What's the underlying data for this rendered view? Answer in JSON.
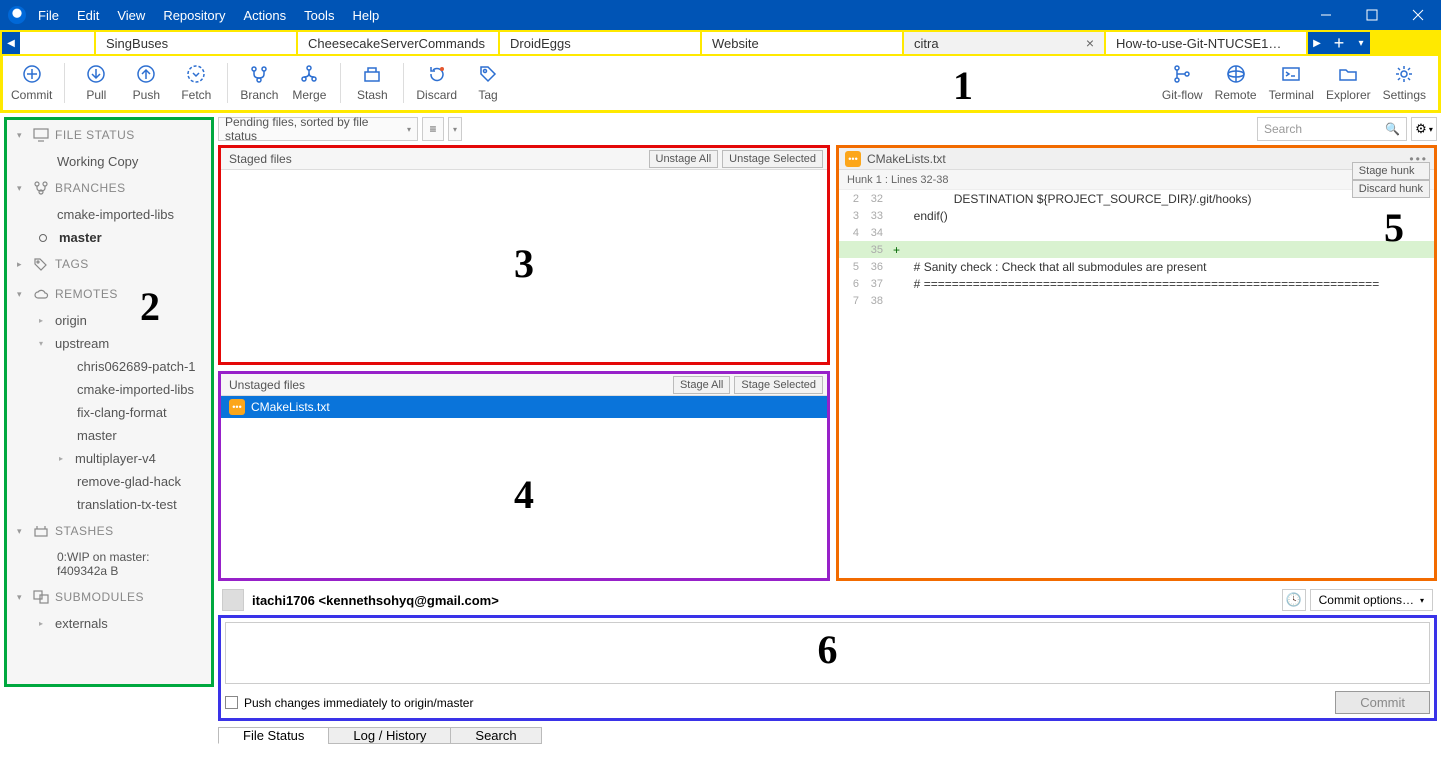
{
  "menu": [
    "File",
    "Edit",
    "View",
    "Repository",
    "Actions",
    "Tools",
    "Help"
  ],
  "tabs": {
    "left_blank": "",
    "items": [
      "SingBuses",
      "CheesecakeServerCommands",
      "DroidEggs",
      "Website",
      "citra",
      "How-to-use-Git-NTUCSE1…"
    ],
    "active": "citra"
  },
  "toolbar": {
    "commit": "Commit",
    "pull": "Pull",
    "push": "Push",
    "fetch": "Fetch",
    "branch": "Branch",
    "merge": "Merge",
    "stash": "Stash",
    "discard": "Discard",
    "tag": "Tag",
    "gitflow": "Git-flow",
    "remote": "Remote",
    "terminal": "Terminal",
    "explorer": "Explorer",
    "settings": "Settings"
  },
  "sidebar": {
    "file_status": {
      "header": "FILE STATUS",
      "working": "Working Copy"
    },
    "branches": {
      "header": "BRANCHES",
      "items": [
        "cmake-imported-libs",
        "master"
      ]
    },
    "tags": {
      "header": "TAGS"
    },
    "remotes": {
      "header": "REMOTES",
      "origin": "origin",
      "upstream": "upstream",
      "upstream_items": [
        "chris062689-patch-1",
        "cmake-imported-libs",
        "fix-clang-format",
        "master",
        "multiplayer-v4",
        "remove-glad-hack",
        "translation-tx-test"
      ]
    },
    "stashes": {
      "header": "STASHES",
      "item": "0:WIP on master: f409342a B"
    },
    "submodules": {
      "header": "SUBMODULES",
      "item": "externals"
    }
  },
  "filter": {
    "sort": "Pending files, sorted by file status",
    "search_placeholder": "Search"
  },
  "staged": {
    "title": "Staged files",
    "unstage_all": "Unstage All",
    "unstage_sel": "Unstage Selected"
  },
  "unstaged": {
    "title": "Unstaged files",
    "stage_all": "Stage All",
    "stage_sel": "Stage Selected",
    "file": "CMakeLists.txt"
  },
  "diff": {
    "file": "CMakeLists.txt",
    "hunk": "Hunk 1 : Lines 32-38",
    "stage_hunk": "Stage hunk",
    "discard_hunk": "Discard hunk",
    "lines": [
      {
        "o": "2",
        "n": "32",
        "t": "                DESTINATION ${PROJECT_SOURCE_DIR}/.git/hooks)",
        "k": "ctx"
      },
      {
        "o": "3",
        "n": "33",
        "t": "    endif()",
        "k": "ctx"
      },
      {
        "o": "4",
        "n": "34",
        "t": "",
        "k": "ctx"
      },
      {
        "o": "",
        "n": "35",
        "t": "",
        "k": "added"
      },
      {
        "o": "5",
        "n": "36",
        "t": "    # Sanity check : Check that all submodules are present",
        "k": "ctx"
      },
      {
        "o": "6",
        "n": "37",
        "t": "    # =================================================================",
        "k": "ctx"
      },
      {
        "o": "7",
        "n": "38",
        "t": "",
        "k": "ctx"
      }
    ]
  },
  "commit": {
    "author_name": "itachi1706",
    "author_email": "<kennethsohyq@gmail.com>",
    "options": "Commit options…",
    "push_chk": "Push changes immediately to origin/master",
    "button": "Commit"
  },
  "bottom": {
    "file_status": "File Status",
    "log": "Log / History",
    "search": "Search"
  },
  "annotations": {
    "a1": "1",
    "a2": "2",
    "a3": "3",
    "a4": "4",
    "a5": "5",
    "a6": "6"
  }
}
